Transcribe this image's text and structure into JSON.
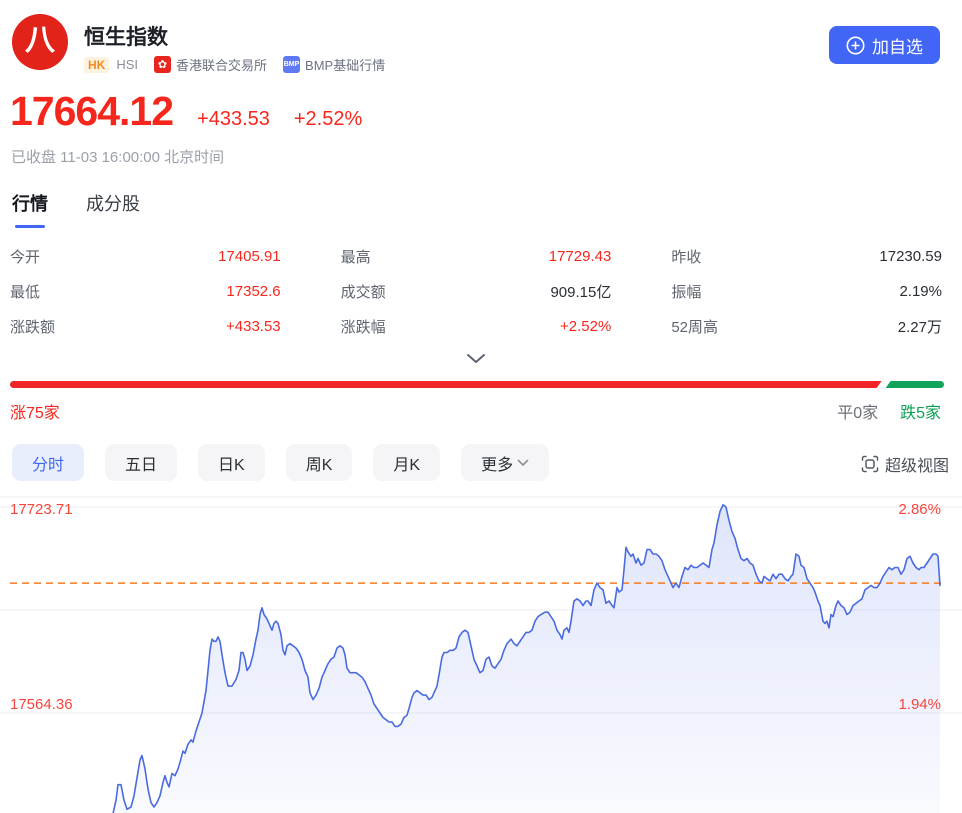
{
  "header": {
    "title": "恒生指数",
    "market_badge": "HK",
    "code": "HSI",
    "exchange_icon": "hk-bauhinia-flower",
    "exchange": "香港联合交易所",
    "quote_level_badge": "BMP",
    "quote_level": "BMP基础行情",
    "add_watchlist_label": "加自选"
  },
  "quote": {
    "price": "17664.12",
    "change": "+433.53",
    "change_pct": "+2.52%",
    "status": "已收盘 11-03 16:00:00 北京时间"
  },
  "tabs": [
    {
      "label": "行情",
      "active": true
    },
    {
      "label": "成分股",
      "active": false
    }
  ],
  "stats": [
    {
      "label": "今开",
      "value": "17405.91",
      "red": true
    },
    {
      "label": "最高",
      "value": "17729.43",
      "red": true
    },
    {
      "label": "昨收",
      "value": "17230.59",
      "red": false
    },
    {
      "label": "最低",
      "value": "17352.6",
      "red": true
    },
    {
      "label": "成交额",
      "value": "909.15亿",
      "red": false
    },
    {
      "label": "振幅",
      "value": "2.19%",
      "red": false
    },
    {
      "label": "涨跌额",
      "value": "+433.53",
      "red": true
    },
    {
      "label": "涨跌幅",
      "value": "+2.52%",
      "red": true
    },
    {
      "label": "52周高",
      "value": "2.27万",
      "red": false
    }
  ],
  "breadth": {
    "up": 75,
    "flat": 0,
    "down": 5,
    "up_label": "涨75家",
    "flat_label": "平0家",
    "down_label": "跌5家"
  },
  "periods": [
    {
      "label": "分时",
      "active": true,
      "dropdown": false
    },
    {
      "label": "五日",
      "active": false,
      "dropdown": false
    },
    {
      "label": "日K",
      "active": false,
      "dropdown": false
    },
    {
      "label": "周K",
      "active": false,
      "dropdown": false
    },
    {
      "label": "月K",
      "active": false,
      "dropdown": false
    },
    {
      "label": "更多",
      "active": false,
      "dropdown": true
    }
  ],
  "super_view_label": "超级视图",
  "colors": {
    "red": "#f5271d",
    "green": "#12a35b",
    "blue": "#4165f5",
    "line_blue": "#4a6be0",
    "dash_orange": "#f57a1f",
    "chart_label_red": "#f4463d",
    "gridline": "#ededf1"
  },
  "chart_data": {
    "type": "line",
    "description": "intraday percent-change line of Hang Seng Index",
    "y_axis": {
      "top_price_label": "17723.71",
      "top_pct_label": "2.86%",
      "bottom_price_label": "17564.36",
      "bottom_pct_label": "1.94%",
      "top_pct": 2.86,
      "bottom_pct": 1.94,
      "gridline_pcts": [
        2.86,
        2.4,
        1.94
      ]
    },
    "last_price_dash_pct": 2.52,
    "x_unit": "px offset from left edge (time axis, session start left)",
    "y_unit": "percent change vs previous close 17230.59",
    "points_x_pct": [
      [
        113,
        1.49
      ],
      [
        116,
        1.55
      ],
      [
        118,
        1.62
      ],
      [
        121,
        1.62
      ],
      [
        124,
        1.55
      ],
      [
        127,
        1.51
      ],
      [
        131,
        1.52
      ],
      [
        134,
        1.57
      ],
      [
        137,
        1.65
      ],
      [
        140,
        1.73
      ],
      [
        142,
        1.75
      ],
      [
        145,
        1.69
      ],
      [
        148,
        1.6
      ],
      [
        151,
        1.54
      ],
      [
        154,
        1.52
      ],
      [
        157,
        1.54
      ],
      [
        160,
        1.57
      ],
      [
        163,
        1.63
      ],
      [
        165,
        1.66
      ],
      [
        167,
        1.63
      ],
      [
        169,
        1.61
      ],
      [
        172,
        1.67
      ],
      [
        175,
        1.66
      ],
      [
        178,
        1.69
      ],
      [
        180,
        1.72
      ],
      [
        183,
        1.77
      ],
      [
        185,
        1.76
      ],
      [
        188,
        1.8
      ],
      [
        191,
        1.82
      ],
      [
        193,
        1.81
      ],
      [
        196,
        1.86
      ],
      [
        199,
        1.9
      ],
      [
        202,
        1.94
      ],
      [
        204,
        1.99
      ],
      [
        206,
        2.04
      ],
      [
        208,
        2.13
      ],
      [
        210,
        2.22
      ],
      [
        212,
        2.27
      ],
      [
        214,
        2.26
      ],
      [
        216,
        2.26
      ],
      [
        218,
        2.28
      ],
      [
        220,
        2.26
      ],
      [
        222,
        2.2
      ],
      [
        225,
        2.12
      ],
      [
        228,
        2.06
      ],
      [
        232,
        2.06
      ],
      [
        236,
        2.09
      ],
      [
        239,
        2.13
      ],
      [
        241,
        2.21
      ],
      [
        243,
        2.21
      ],
      [
        245,
        2.18
      ],
      [
        247,
        2.13
      ],
      [
        250,
        2.15
      ],
      [
        253,
        2.2
      ],
      [
        256,
        2.27
      ],
      [
        258,
        2.31
      ],
      [
        260,
        2.38
      ],
      [
        262,
        2.41
      ],
      [
        264,
        2.38
      ],
      [
        267,
        2.36
      ],
      [
        270,
        2.33
      ],
      [
        272,
        2.31
      ],
      [
        274,
        2.34
      ],
      [
        276,
        2.35
      ],
      [
        278,
        2.34
      ],
      [
        281,
        2.29
      ],
      [
        283,
        2.22
      ],
      [
        285,
        2.2
      ],
      [
        287,
        2.24
      ],
      [
        290,
        2.25
      ],
      [
        293,
        2.24
      ],
      [
        296,
        2.23
      ],
      [
        299,
        2.21
      ],
      [
        302,
        2.18
      ],
      [
        305,
        2.13
      ],
      [
        308,
        2.1
      ],
      [
        310,
        2.03
      ],
      [
        313,
        2.0
      ],
      [
        316,
        2.02
      ],
      [
        319,
        2.05
      ],
      [
        322,
        2.1
      ],
      [
        325,
        2.13
      ],
      [
        328,
        2.16
      ],
      [
        331,
        2.18
      ],
      [
        334,
        2.19
      ],
      [
        337,
        2.23
      ],
      [
        340,
        2.24
      ],
      [
        343,
        2.23
      ],
      [
        345,
        2.2
      ],
      [
        347,
        2.14
      ],
      [
        350,
        2.12
      ],
      [
        356,
        2.12
      ],
      [
        359,
        2.11
      ],
      [
        362,
        2.1
      ],
      [
        365,
        2.08
      ],
      [
        368,
        2.05
      ],
      [
        371,
        2.02
      ],
      [
        374,
        1.98
      ],
      [
        377,
        1.96
      ],
      [
        380,
        1.94
      ],
      [
        383,
        1.92
      ],
      [
        386,
        1.91
      ],
      [
        389,
        1.9
      ],
      [
        392,
        1.9
      ],
      [
        395,
        1.88
      ],
      [
        398,
        1.88
      ],
      [
        401,
        1.89
      ],
      [
        404,
        1.92
      ],
      [
        407,
        1.93
      ],
      [
        409,
        1.96
      ],
      [
        412,
        2.01
      ],
      [
        414,
        2.03
      ],
      [
        417,
        2.04
      ],
      [
        420,
        2.03
      ],
      [
        423,
        2.02
      ],
      [
        426,
        2.02
      ],
      [
        429,
        2.0
      ],
      [
        432,
        2.01
      ],
      [
        435,
        2.04
      ],
      [
        437,
        2.06
      ],
      [
        439,
        2.11
      ],
      [
        442,
        2.19
      ],
      [
        444,
        2.21
      ],
      [
        447,
        2.21
      ],
      [
        450,
        2.22
      ],
      [
        453,
        2.22
      ],
      [
        456,
        2.23
      ],
      [
        459,
        2.28
      ],
      [
        462,
        2.3
      ],
      [
        465,
        2.31
      ],
      [
        468,
        2.3
      ],
      [
        471,
        2.24
      ],
      [
        474,
        2.18
      ],
      [
        477,
        2.15
      ],
      [
        480,
        2.12
      ],
      [
        483,
        2.13
      ],
      [
        486,
        2.18
      ],
      [
        489,
        2.19
      ],
      [
        492,
        2.15
      ],
      [
        495,
        2.14
      ],
      [
        498,
        2.16
      ],
      [
        501,
        2.18
      ],
      [
        504,
        2.22
      ],
      [
        507,
        2.25
      ],
      [
        511,
        2.27
      ],
      [
        514,
        2.25
      ],
      [
        517,
        2.24
      ],
      [
        520,
        2.26
      ],
      [
        523,
        2.28
      ],
      [
        526,
        2.3
      ],
      [
        529,
        2.3
      ],
      [
        532,
        2.31
      ],
      [
        535,
        2.35
      ],
      [
        538,
        2.37
      ],
      [
        541,
        2.38
      ],
      [
        545,
        2.39
      ],
      [
        548,
        2.39
      ],
      [
        551,
        2.37
      ],
      [
        554,
        2.35
      ],
      [
        557,
        2.31
      ],
      [
        560,
        2.29
      ],
      [
        562,
        2.27
      ],
      [
        564,
        2.31
      ],
      [
        567,
        2.32
      ],
      [
        569,
        2.3
      ],
      [
        571,
        2.35
      ],
      [
        574,
        2.44
      ],
      [
        577,
        2.45
      ],
      [
        580,
        2.44
      ],
      [
        583,
        2.42
      ],
      [
        586,
        2.44
      ],
      [
        588,
        2.44
      ],
      [
        591,
        2.42
      ],
      [
        594,
        2.49
      ],
      [
        597,
        2.52
      ],
      [
        600,
        2.5
      ],
      [
        603,
        2.49
      ],
      [
        606,
        2.43
      ],
      [
        609,
        2.44
      ],
      [
        612,
        2.42
      ],
      [
        614,
        2.41
      ],
      [
        617,
        2.5
      ],
      [
        619,
        2.48
      ],
      [
        622,
        2.49
      ],
      [
        624,
        2.58
      ],
      [
        626,
        2.68
      ],
      [
        628,
        2.66
      ],
      [
        631,
        2.64
      ],
      [
        633,
        2.65
      ],
      [
        636,
        2.61
      ],
      [
        638,
        2.63
      ],
      [
        641,
        2.6
      ],
      [
        644,
        2.61
      ],
      [
        647,
        2.67
      ],
      [
        650,
        2.67
      ],
      [
        653,
        2.65
      ],
      [
        656,
        2.65
      ],
      [
        659,
        2.64
      ],
      [
        662,
        2.62
      ],
      [
        665,
        2.58
      ],
      [
        668,
        2.55
      ],
      [
        671,
        2.52
      ],
      [
        673,
        2.5
      ],
      [
        676,
        2.52
      ],
      [
        679,
        2.5
      ],
      [
        682,
        2.55
      ],
      [
        685,
        2.59
      ],
      [
        688,
        2.58
      ],
      [
        691,
        2.6
      ],
      [
        694,
        2.59
      ],
      [
        697,
        2.59
      ],
      [
        700,
        2.6
      ],
      [
        703,
        2.61
      ],
      [
        706,
        2.6
      ],
      [
        709,
        2.59
      ],
      [
        712,
        2.67
      ],
      [
        714,
        2.7
      ],
      [
        717,
        2.78
      ],
      [
        720,
        2.84
      ],
      [
        723,
        2.87
      ],
      [
        726,
        2.86
      ],
      [
        729,
        2.8
      ],
      [
        732,
        2.75
      ],
      [
        735,
        2.72
      ],
      [
        738,
        2.67
      ],
      [
        741,
        2.63
      ],
      [
        744,
        2.62
      ],
      [
        747,
        2.63
      ],
      [
        750,
        2.61
      ],
      [
        753,
        2.6
      ],
      [
        756,
        2.56
      ],
      [
        759,
        2.53
      ],
      [
        762,
        2.52
      ],
      [
        764,
        2.55
      ],
      [
        767,
        2.54
      ],
      [
        770,
        2.53
      ],
      [
        773,
        2.56
      ],
      [
        776,
        2.54
      ],
      [
        779,
        2.56
      ],
      [
        782,
        2.56
      ],
      [
        785,
        2.54
      ],
      [
        788,
        2.53
      ],
      [
        791,
        2.55
      ],
      [
        793,
        2.56
      ],
      [
        796,
        2.65
      ],
      [
        799,
        2.64
      ],
      [
        801,
        2.6
      ],
      [
        804,
        2.59
      ],
      [
        807,
        2.54
      ],
      [
        810,
        2.52
      ],
      [
        813,
        2.5
      ],
      [
        815,
        2.48
      ],
      [
        818,
        2.44
      ],
      [
        820,
        2.42
      ],
      [
        823,
        2.35
      ],
      [
        825,
        2.34
      ],
      [
        827,
        2.35
      ],
      [
        829,
        2.32
      ],
      [
        831,
        2.38
      ],
      [
        833,
        2.37
      ],
      [
        836,
        2.42
      ],
      [
        838,
        2.44
      ],
      [
        841,
        2.42
      ],
      [
        844,
        2.41
      ],
      [
        847,
        2.38
      ],
      [
        850,
        2.39
      ],
      [
        853,
        2.42
      ],
      [
        856,
        2.43
      ],
      [
        859,
        2.44
      ],
      [
        862,
        2.45
      ],
      [
        865,
        2.49
      ],
      [
        868,
        2.5
      ],
      [
        871,
        2.51
      ],
      [
        874,
        2.5
      ],
      [
        877,
        2.5
      ],
      [
        880,
        2.52
      ],
      [
        883,
        2.55
      ],
      [
        886,
        2.57
      ],
      [
        889,
        2.59
      ],
      [
        892,
        2.58
      ],
      [
        895,
        2.59
      ],
      [
        898,
        2.59
      ],
      [
        901,
        2.56
      ],
      [
        904,
        2.58
      ],
      [
        907,
        2.63
      ],
      [
        910,
        2.64
      ],
      [
        913,
        2.61
      ],
      [
        916,
        2.59
      ],
      [
        919,
        2.58
      ],
      [
        921,
        2.59
      ],
      [
        924,
        2.59
      ],
      [
        927,
        2.61
      ],
      [
        930,
        2.63
      ],
      [
        933,
        2.65
      ],
      [
        936,
        2.65
      ],
      [
        938,
        2.64
      ],
      [
        940,
        2.51
      ]
    ]
  }
}
